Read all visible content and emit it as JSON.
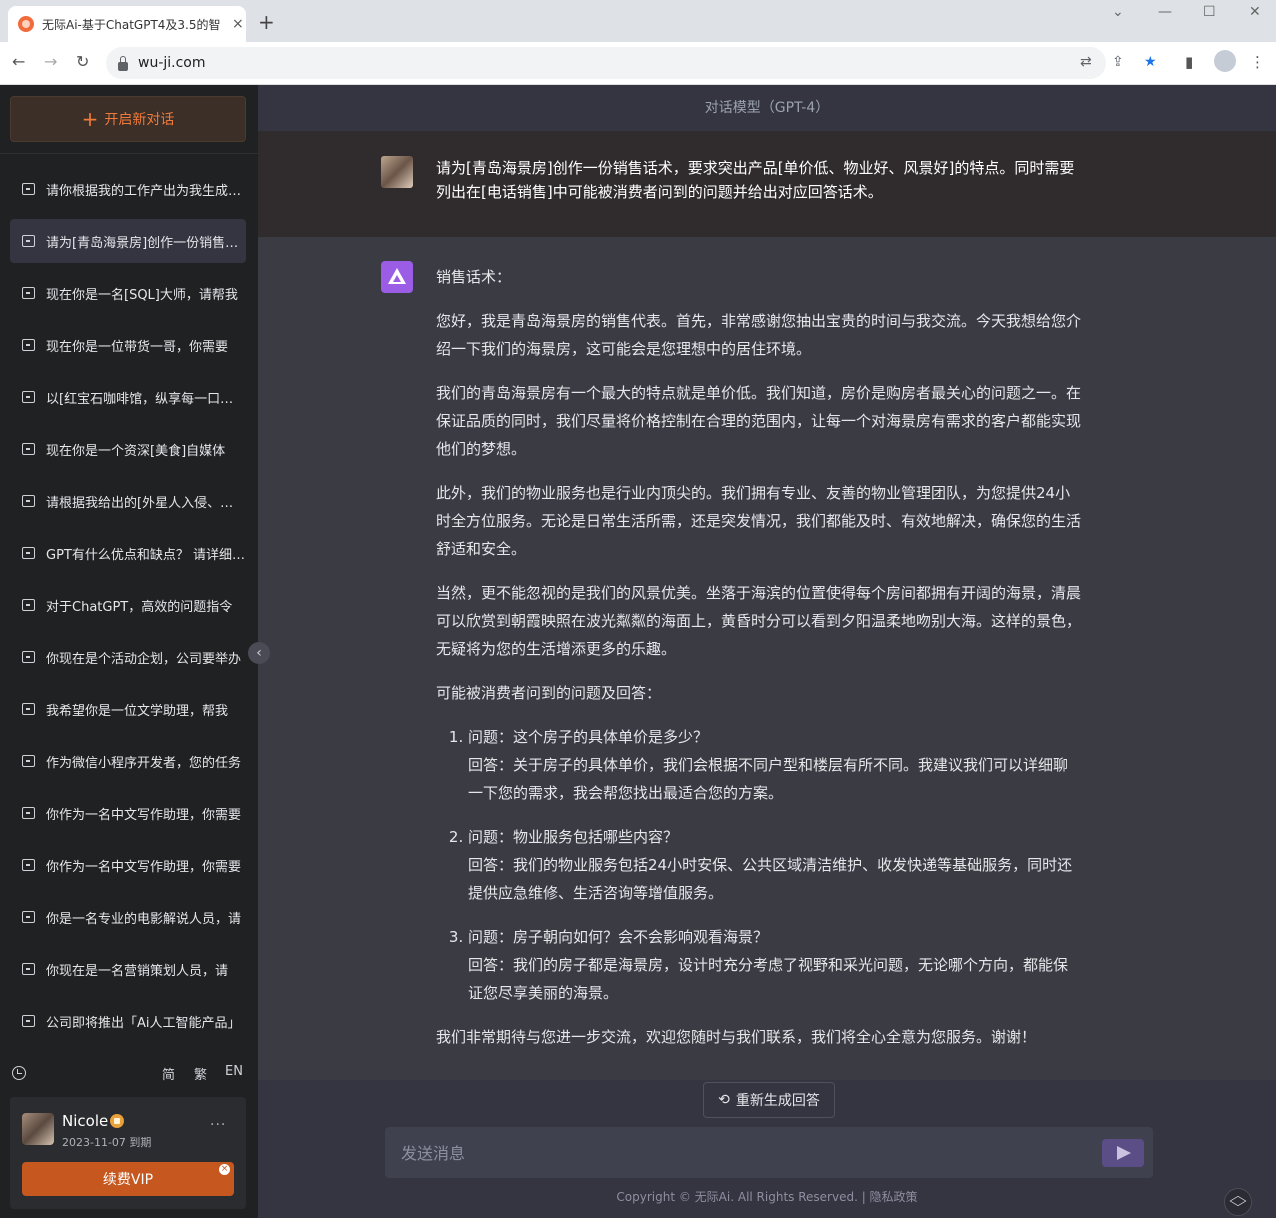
{
  "browser": {
    "tab_title": "无际Ai-基于ChatGPT4及3.5的智",
    "tab_close": "×",
    "new_tab": "+",
    "url": "wu-ji.com",
    "win_chevron": "⌄",
    "win_min": "—",
    "win_max": "☐",
    "win_close": "✕"
  },
  "sidebar": {
    "new_chat": "开启新对话",
    "conversations": [
      "请你根据我的工作产出为我生成一份周报",
      "请为[青岛海景房]创作一份销售话术",
      "现在你是一名[SQL]大师，请帮我",
      "现在你是一位带货一哥，你需要",
      "以[红宝石咖啡馆，纵享每一口的美好]",
      "现在你是一个资深[美食]自媒体",
      "请根据我给出的[外星人入侵、地球]",
      "GPT有什么优点和缺点？ 请详细说明",
      "对于ChatGPT，高效的问题指令",
      "你现在是个活动企划，公司要举办",
      "我希望你是一位文学助理，帮我",
      "作为微信小程序开发者，您的任务",
      "你作为一名中文写作助理，你需要",
      "你作为一名中文写作助理，你需要",
      "你是一名专业的电影解说人员，请",
      "你现在是一名营销策划人员，请",
      "公司即将推出「Ai人工智能产品」"
    ],
    "lang": {
      "simplified": "简",
      "traditional": "繁",
      "english": "EN"
    },
    "user": {
      "name": "Nicole",
      "expiry": "2023-11-07 到期",
      "more": "···",
      "renew": "续费VIP",
      "renew_close": "×"
    }
  },
  "main": {
    "model_title": "对话模型（GPT-4）",
    "user_message": "请为[青岛海景房]创作一份销售话术，要求突出产品[单价低、物业好、风景好]的特点。同时需要列出在[电话销售]中可能被消费者问到的问题并给出对应回答话术。",
    "bot": {
      "heading": "销售话术：",
      "paragraphs": [
        "您好，我是青岛海景房的销售代表。首先，非常感谢您抽出宝贵的时间与我交流。今天我想给您介绍一下我们的海景房，这可能会是您理想中的居住环境。",
        "我们的青岛海景房有一个最大的特点就是单价低。我们知道，房价是购房者最关心的问题之一。在保证品质的同时，我们尽量将价格控制在合理的范围内，让每一个对海景房有需求的客户都能实现他们的梦想。",
        "此外，我们的物业服务也是行业内顶尖的。我们拥有专业、友善的物业管理团队，为您提供24小时全方位服务。无论是日常生活所需，还是突发情况，我们都能及时、有效地解决，确保您的生活舒适和安全。",
        "当然，更不能忽视的是我们的风景优美。坐落于海滨的位置使得每个房间都拥有开阔的海景，清晨可以欣赏到朝霞映照在波光粼粼的海面上，黄昏时分可以看到夕阳温柔地吻别大海。这样的景色，无疑将为您的生活增添更多的乐趣。"
      ],
      "qa_heading": "可能被消费者问到的问题及回答：",
      "qa": [
        {
          "q": "问题：这个房子的具体单价是多少？",
          "a": "回答：关于房子的具体单价，我们会根据不同户型和楼层有所不同。我建议我们可以详细聊一下您的需求，我会帮您找出最适合您的方案。"
        },
        {
          "q": "问题：物业服务包括哪些内容？",
          "a": "回答：我们的物业服务包括24小时安保、公共区域清洁维护、收发快递等基础服务，同时还提供应急维修、生活咨询等增值服务。"
        },
        {
          "q": "问题：房子朝向如何？会不会影响观看海景？",
          "a": "回答：我们的房子都是海景房，设计时充分考虑了视野和采光问题，无论哪个方向，都能保证您尽享美丽的海景。"
        }
      ],
      "closing": "我们非常期待与您进一步交流，欢迎您随时与我们联系，我们将全心全意为您服务。谢谢！"
    },
    "regenerate": "重新生成回答",
    "input_placeholder": "发送消息",
    "copyright": "Copyright © 无际Ai. All Rights Reserved. | 隐私政策"
  }
}
